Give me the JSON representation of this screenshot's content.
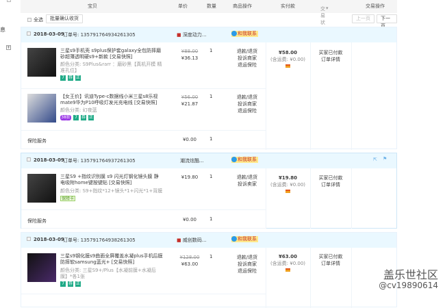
{
  "left": {
    "label": "息"
  },
  "header": {
    "cols": [
      "宝贝",
      "单价",
      "数量",
      "商品操作",
      "实付款",
      "交易状态",
      "交易操作"
    ]
  },
  "toolbar": {
    "select_all": "全选",
    "batch_confirm": "批量确认收货",
    "prev": "上一页",
    "next": "下一页"
  },
  "orders": [
    {
      "date": "2018-03-09",
      "order_no": "订单号: 135791764934261305",
      "shop": "深度动力...",
      "contact": "和我联系",
      "pay": "¥58.00",
      "shipping": "(含运费: ¥0.00)",
      "status": "买家已付款",
      "detail": "订单详情",
      "items": [
        {
          "title": "三星s9手机壳 s9plus保护套galaxy全包防摔磨砂超薄透明硬s9+新款 [交易快照]",
          "sku": "颜色分类: S9Plus&rarr ：磨砂黑【真机开模 精准孔位】",
          "orig": "¥88.00",
          "price": "¥36.13",
          "qty": "1",
          "ops": [
            "退款/退货",
            "投诉商家",
            "退运保险"
          ],
          "tags": [
            "7",
            "券",
            "正"
          ]
        },
        {
          "title": "【女王价】讯迪Type-c数据线小米三星s8乐视mate9华为P10呼吸灯发光充电线 [交易快照]",
          "sku": "颜色分类: 幻夜蓝",
          "orig": "¥56.00",
          "price": "¥21.87",
          "qty": "1",
          "ops": [
            "退款/退货",
            "投诉商家",
            "退运保险"
          ],
          "badge": "38狂欢",
          "tags": [
            "7",
            "券",
            "正"
          ]
        }
      ],
      "insurance": {
        "label": "保险服务",
        "price": "¥0.00",
        "qty": "1"
      }
    },
    {
      "date": "2018-03-09",
      "order_no": "订单号: 135791764937261305",
      "shop": "潮流炫酷...",
      "contact": "和我联系",
      "pay": "¥19.80",
      "shipping": "(含运费: ¥0.00)",
      "status": "买家已付款",
      "detail": "订单详情",
      "items": [
        {
          "title": "三星S9 +指纹识别膜 s9 闪光灯钢化镜头膜 静电吸附home键按键贴 [交易快照]",
          "sku": "颜色分类: S9+指纹*12+镜头*1+闪光*1+背膜",
          "price": "¥19.80",
          "qty": "1",
          "ops": [
            "退款/退货",
            "投诉卖家"
          ],
          "badge2": "保障卡"
        }
      ],
      "insurance": {
        "label": "保险服务",
        "price": "¥0.00",
        "qty": "1"
      }
    },
    {
      "date": "2018-03-09",
      "order_no": "订单号: 135791764938261305",
      "shop": "威创数码...",
      "contact": "和我联系",
      "pay": "¥63.00",
      "shipping": "(含运费: ¥0.00)",
      "status": "买家已付款",
      "detail": "订单详情",
      "items": [
        {
          "title": "三星s9钢化膜s9曲面全屏覆盖水凝plus手机后膜防摔软samsung蓝光+ [交易快照]",
          "sku": "颜色分类: 三星S9+/Plus【水凝前膜+水凝后膜】*各1张",
          "orig": "¥128.00",
          "price": "¥63.00",
          "qty": "1",
          "ops": [
            "退款/退货",
            "投诉商家",
            "退运保险"
          ],
          "tags": [
            "7",
            "券",
            "正"
          ]
        }
      ]
    }
  ],
  "watermark": {
    "line1": "盖乐世社区",
    "line2": "@cv19890614"
  }
}
